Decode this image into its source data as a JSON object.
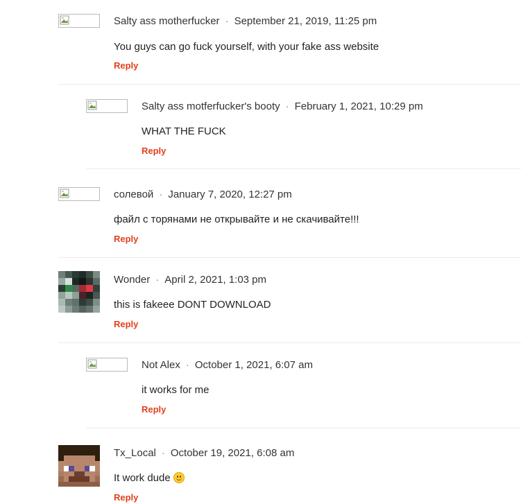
{
  "comments": [
    {
      "author": "Salty ass motherfucker",
      "date": "September 21, 2019, 11:25 pm",
      "text": "You guys can go fuck yourself, with your fake ass website",
      "reply": "Reply"
    },
    {
      "author": "Salty ass motferfucker's booty",
      "date": "February 1, 2021, 10:29 pm",
      "text": "WHAT THE FUCK",
      "reply": "Reply"
    },
    {
      "author": "солевой",
      "date": "January 7, 2020, 12:27 pm",
      "text": "файл с торянами не открывайте и не скачивайте!!!",
      "reply": "Reply"
    },
    {
      "author": "Wonder",
      "date": "April 2, 2021, 1:03 pm",
      "text": "this is fakeee DONT DOWNLOAD",
      "reply": "Reply"
    },
    {
      "author": "Not Alex",
      "date": "October 1, 2021, 6:07 am",
      "text": "it works for me",
      "reply": "Reply"
    },
    {
      "author": "Tx_Local",
      "date": "October 19, 2021, 6:08 am",
      "text": "It work dude",
      "reply": "Reply"
    }
  ],
  "meta_separator": "·",
  "colors": {
    "reply": "#e2401c",
    "divider": "#ececec",
    "text": "#222222"
  },
  "icons": {
    "broken_avatar": "broken-image-icon",
    "emoji": "slightly-smiling-face-icon"
  }
}
